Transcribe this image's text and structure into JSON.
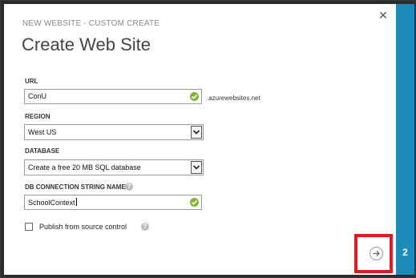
{
  "dialog": {
    "subtitle": "NEW WEBSITE - CUSTOM CREATE",
    "title": "Create Web Site",
    "close_icon": "close-icon",
    "step_number": "2"
  },
  "form": {
    "url": {
      "label": "URL",
      "value": "ConU",
      "suffix": ".azurewebsites.net",
      "valid": true
    },
    "region": {
      "label": "REGION",
      "selected": "West US"
    },
    "database": {
      "label": "DATABASE",
      "selected": "Create a free 20 MB SQL database"
    },
    "connection_string": {
      "label": "DB CONNECTION STRING NAME",
      "value": "SchoolContext",
      "valid": true
    },
    "publish": {
      "label": "Publish from source control",
      "checked": false
    }
  },
  "footer": {
    "next_icon": "arrow-right-icon"
  },
  "colors": {
    "accent": "#1e8cb8",
    "valid": "#7cb82f",
    "highlight": "#e11b22"
  }
}
